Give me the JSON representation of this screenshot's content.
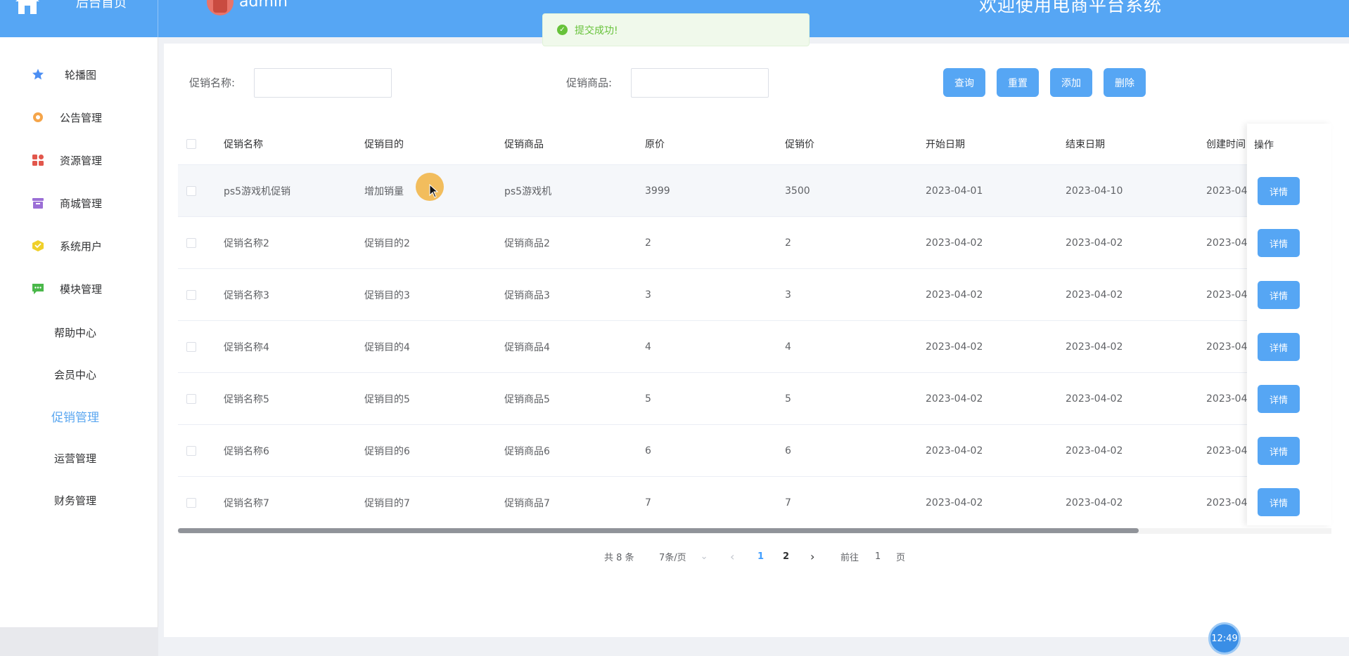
{
  "header": {
    "brand_label": "后台首页",
    "admin_name": "admin",
    "welcome": "欢迎使用电商平台系统"
  },
  "toast": {
    "message": "提交成功!"
  },
  "sidebar": {
    "items": [
      {
        "label": "轮播图",
        "icon": "star-icon",
        "color": "#4b8ef3"
      },
      {
        "label": "公告管理",
        "icon": "gear-icon",
        "color": "#f5a54a"
      },
      {
        "label": "资源管理",
        "icon": "grid-icon",
        "color": "#e2574c"
      },
      {
        "label": "商城管理",
        "icon": "archive-icon",
        "color": "#9b6fd6"
      },
      {
        "label": "系统用户",
        "icon": "cube-icon",
        "color": "#f0d02a"
      },
      {
        "label": "模块管理",
        "icon": "chat-icon",
        "color": "#4ab84a"
      }
    ],
    "sub_items": [
      {
        "label": "帮助中心"
      },
      {
        "label": "会员中心"
      },
      {
        "label": "促销管理",
        "active": true
      },
      {
        "label": "运营管理"
      },
      {
        "label": "财务管理"
      }
    ]
  },
  "search": {
    "name_label": "促销名称:",
    "name_value": "",
    "product_label": "促销商品:",
    "product_value": ""
  },
  "toolbar": {
    "query": "查询",
    "reset": "重置",
    "add": "添加",
    "delete": "删除"
  },
  "table": {
    "columns": [
      "促销名称",
      "促销目的",
      "促销商品",
      "原价",
      "促销价",
      "开始日期",
      "结束日期",
      "创建时间"
    ],
    "op_column": "操作",
    "detail_label": "详情",
    "rows": [
      [
        "ps5游戏机促销",
        "增加销量",
        "ps5游戏机",
        "3999",
        "3500",
        "2023-04-01",
        "2023-04-10",
        "2023-04-"
      ],
      [
        "促销名称2",
        "促销目的2",
        "促销商品2",
        "2",
        "2",
        "2023-04-02",
        "2023-04-02",
        "2023-04-"
      ],
      [
        "促销名称3",
        "促销目的3",
        "促销商品3",
        "3",
        "3",
        "2023-04-02",
        "2023-04-02",
        "2023-04-"
      ],
      [
        "促销名称4",
        "促销目的4",
        "促销商品4",
        "4",
        "4",
        "2023-04-02",
        "2023-04-02",
        "2023-04-"
      ],
      [
        "促销名称5",
        "促销目的5",
        "促销商品5",
        "5",
        "5",
        "2023-04-02",
        "2023-04-02",
        "2023-04-"
      ],
      [
        "促销名称6",
        "促销目的6",
        "促销商品6",
        "6",
        "6",
        "2023-04-02",
        "2023-04-02",
        "2023-04-"
      ],
      [
        "促销名称7",
        "促销目的7",
        "促销商品7",
        "7",
        "7",
        "2023-04-02",
        "2023-04-02",
        "2023-04-"
      ]
    ]
  },
  "pagination": {
    "total": "共 8 条",
    "page_size": "7条/页",
    "pages": [
      "1",
      "2"
    ],
    "current": "1",
    "goto_prefix": "前往",
    "goto_value": "1",
    "goto_suffix": "页"
  },
  "clock": {
    "time": "12:49"
  }
}
